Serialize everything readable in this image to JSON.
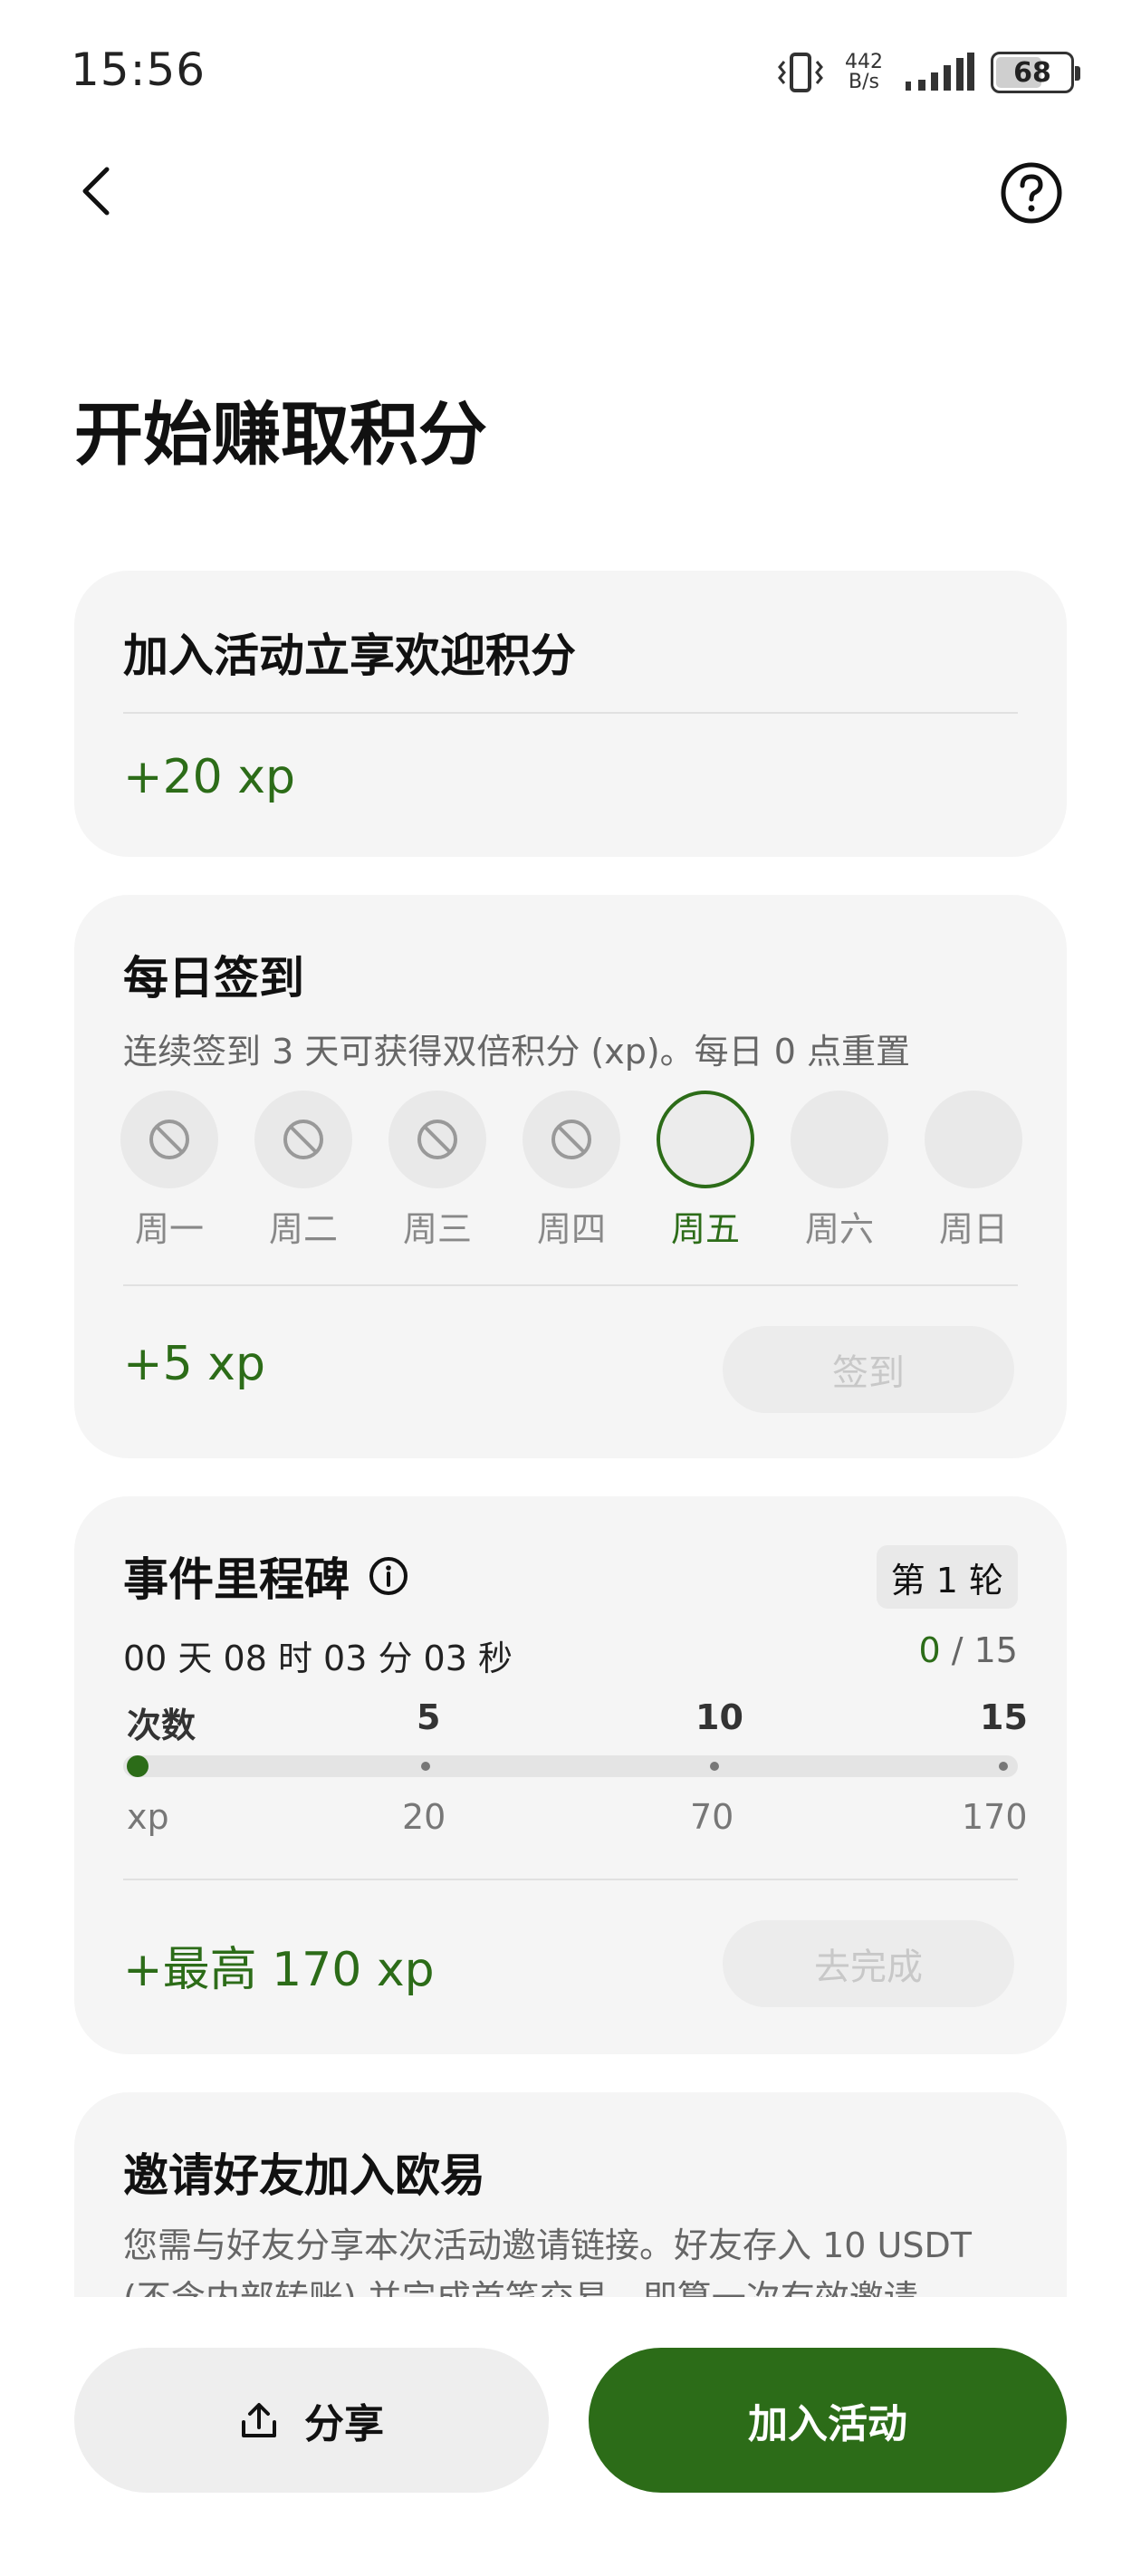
{
  "status_bar": {
    "time": "15:56",
    "net_speed_value": "442",
    "net_speed_unit": "B/s",
    "battery": "68"
  },
  "page": {
    "title": "开始赚取积分"
  },
  "welcome_card": {
    "title": "加入活动立享欢迎积分",
    "xp": "+20 xp"
  },
  "checkin_card": {
    "title": "每日签到",
    "subtitle": "连续签到 3 天可获得双倍积分 (xp)。每日 0 点重置",
    "days": [
      {
        "label": "周一",
        "state": "missed"
      },
      {
        "label": "周二",
        "state": "missed"
      },
      {
        "label": "周三",
        "state": "missed"
      },
      {
        "label": "周四",
        "state": "missed"
      },
      {
        "label": "周五",
        "state": "today"
      },
      {
        "label": "周六",
        "state": "future"
      },
      {
        "label": "周日",
        "state": "future"
      }
    ],
    "xp": "+5 xp",
    "button": "签到"
  },
  "milestone_card": {
    "title": "事件里程碑",
    "round": "第 1 轮",
    "countdown": "00 天 08 时 03 分 03 秒",
    "progress_current": "0",
    "progress_total": " / 15",
    "count_label": "次数",
    "xp_label": "xp",
    "milestones": [
      {
        "count": "5",
        "xp": "20"
      },
      {
        "count": "10",
        "xp": "70"
      },
      {
        "count": "15",
        "xp": "170"
      }
    ],
    "xp": "+最高 170 xp",
    "button": "去完成"
  },
  "invite_card": {
    "title": "邀请好友加入欧易",
    "desc": "您需与好友分享本次活动邀请链接。好友存入 10 USDT (不含内部转账) 并完成首笔交易，即算一次有效邀请。"
  },
  "bottom": {
    "share": "分享",
    "join": "加入活动"
  },
  "colors": {
    "accent": "#2c6c18",
    "card_bg": "#f5f5f5"
  }
}
